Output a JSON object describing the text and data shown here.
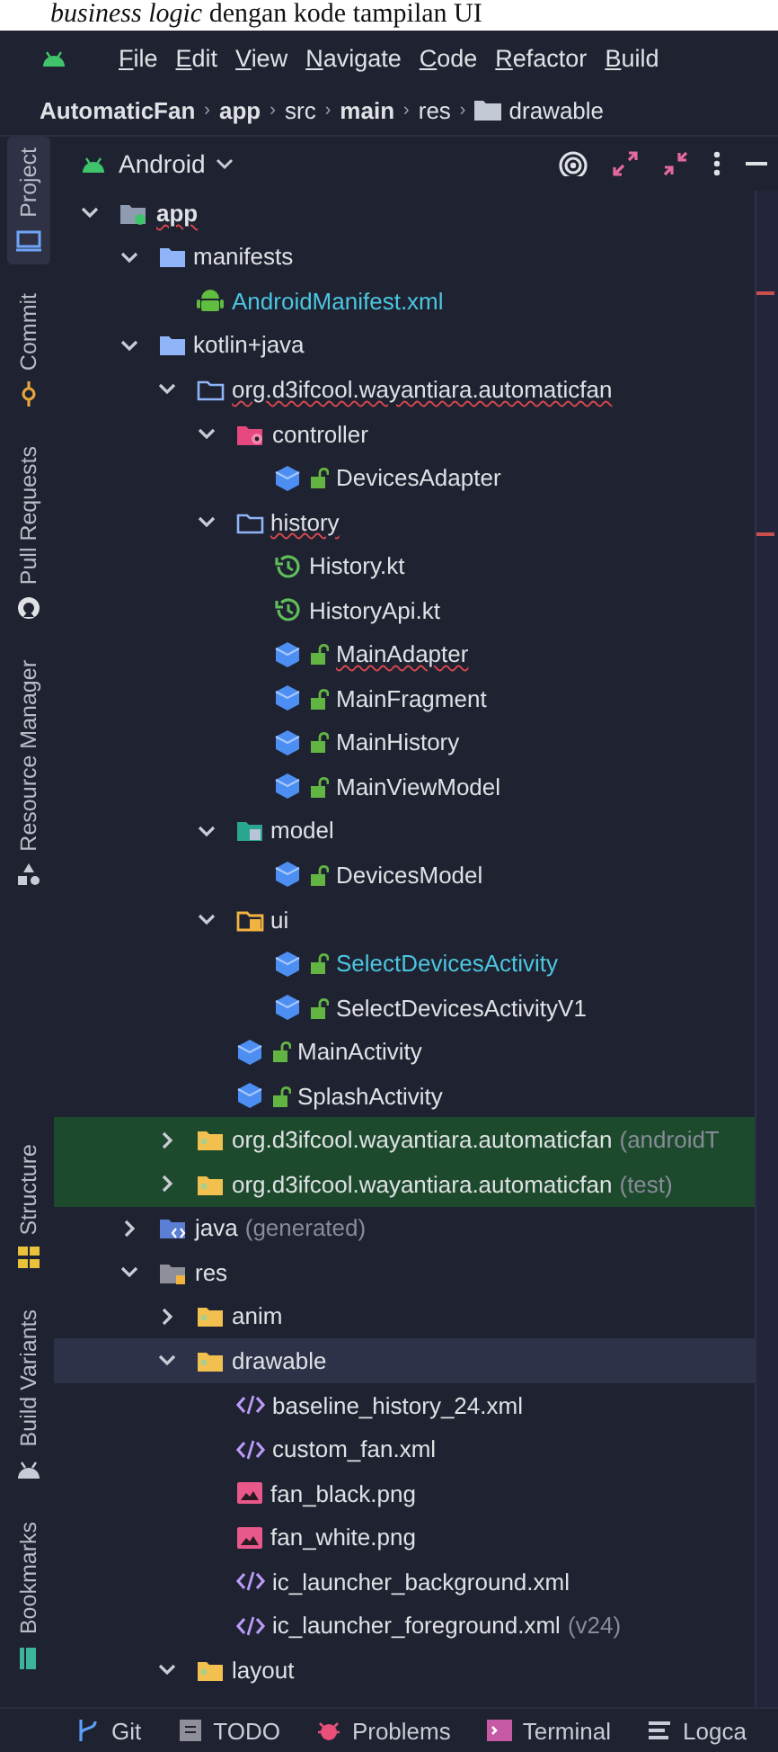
{
  "caption": "*business logic* dengan kode tampilan UI",
  "menu": [
    "File",
    "Edit",
    "View",
    "Navigate",
    "Code",
    "Refactor",
    "Build"
  ],
  "breadcrumb": [
    {
      "label": "AutomaticFan",
      "bold": true,
      "kind": "text"
    },
    {
      "separator": "›",
      "label": "app",
      "bold": true,
      "kind": "text"
    },
    {
      "separator": "›",
      "label": "src",
      "bold": false,
      "kind": "text"
    },
    {
      "separator": "›",
      "label": "main",
      "bold": true,
      "kind": "text"
    },
    {
      "separator": "›",
      "label": "res",
      "bold": false,
      "kind": "text"
    },
    {
      "separator": "›",
      "label": "drawable",
      "bold": false,
      "kind": "folder"
    }
  ],
  "tool_windows_top": [
    {
      "label": "Project",
      "kind": "project",
      "selected": true
    },
    {
      "label": "Commit",
      "kind": "commit",
      "selected": false
    },
    {
      "label": "Pull Requests",
      "kind": "pull",
      "selected": false
    },
    {
      "label": "Resource Manager",
      "kind": "resources",
      "selected": false
    }
  ],
  "tool_windows_bottom": [
    {
      "label": "Structure",
      "kind": "structure",
      "selected": false
    },
    {
      "label": "Build Variants",
      "kind": "variants",
      "selected": false
    },
    {
      "label": "Bookmarks",
      "kind": "bookmarks",
      "selected": false
    }
  ],
  "view_selector": "Android",
  "tree": [
    {
      "label": "app",
      "kind": "module",
      "expanded": true,
      "selected": false,
      "modified": false,
      "error": true,
      "children": [
        {
          "label": "manifests",
          "kind": "folder",
          "expanded": true,
          "selected": false,
          "modified": false,
          "error": false,
          "children": [
            {
              "label": "AndroidManifest.xml",
              "kind": "manifest",
              "selected": false,
              "modified": true,
              "error": false
            }
          ]
        },
        {
          "label": "kotlin+java",
          "kind": "folder",
          "expanded": true,
          "selected": false,
          "modified": false,
          "error": false,
          "children": [
            {
              "label": "org.d3ifcool.wayantiara.automaticfan",
              "kind": "package",
              "expanded": true,
              "selected": false,
              "modified": false,
              "error": true,
              "children": [
                {
                  "label": "controller",
                  "kind": "package-controller",
                  "expanded": true,
                  "selected": false,
                  "modified": false,
                  "error": false,
                  "children": [
                    {
                      "label": "DevicesAdapter",
                      "kind": "class",
                      "selected": false,
                      "modified": false,
                      "error": false
                    }
                  ]
                },
                {
                  "label": "history",
                  "kind": "package",
                  "expanded": true,
                  "selected": false,
                  "modified": false,
                  "error": true,
                  "children": [
                    {
                      "label": "History.kt",
                      "kind": "kotlin-file",
                      "selected": false,
                      "modified": false,
                      "error": false
                    },
                    {
                      "label": "HistoryApi.kt",
                      "kind": "kotlin-file",
                      "selected": false,
                      "modified": false,
                      "error": false
                    },
                    {
                      "label": "MainAdapter",
                      "kind": "class",
                      "selected": false,
                      "modified": false,
                      "error": true
                    },
                    {
                      "label": "MainFragment",
                      "kind": "class",
                      "selected": false,
                      "modified": false,
                      "error": false
                    },
                    {
                      "label": "MainHistory",
                      "kind": "class",
                      "selected": false,
                      "modified": false,
                      "error": false
                    },
                    {
                      "label": "MainViewModel",
                      "kind": "class",
                      "selected": false,
                      "modified": false,
                      "error": false
                    }
                  ]
                },
                {
                  "label": "model",
                  "kind": "package-model",
                  "expanded": true,
                  "selected": false,
                  "modified": false,
                  "error": false,
                  "children": [
                    {
                      "label": "DevicesModel",
                      "kind": "class",
                      "selected": false,
                      "modified": false,
                      "error": false
                    }
                  ]
                },
                {
                  "label": "ui",
                  "kind": "package-ui",
                  "expanded": true,
                  "selected": false,
                  "modified": false,
                  "error": false,
                  "children": [
                    {
                      "label": "SelectDevicesActivity",
                      "kind": "class",
                      "selected": false,
                      "modified": true,
                      "error": false
                    },
                    {
                      "label": "SelectDevicesActivityV1",
                      "kind": "class",
                      "selected": false,
                      "modified": false,
                      "error": false
                    }
                  ]
                },
                {
                  "label": "MainActivity",
                  "kind": "class",
                  "selected": false,
                  "modified": false,
                  "error": false
                },
                {
                  "label": "SplashActivity",
                  "kind": "class",
                  "selected": false,
                  "modified": false,
                  "error": false
                }
              ]
            },
            {
              "label": "org.d3ifcool.wayantiara.automaticfan",
              "note": "(androidT",
              "kind": "test-package",
              "expanded": false,
              "selected": false,
              "modified": false,
              "error": false
            },
            {
              "label": "org.d3ifcool.wayantiara.automaticfan",
              "note": "(test)",
              "kind": "test-package",
              "expanded": false,
              "selected": false,
              "modified": false,
              "error": false
            }
          ]
        },
        {
          "label": "java",
          "note": "(generated)",
          "kind": "generated",
          "expanded": false,
          "selected": false,
          "modified": false,
          "error": false
        },
        {
          "label": "res",
          "kind": "res",
          "expanded": true,
          "selected": false,
          "modified": false,
          "error": false,
          "children": [
            {
              "label": "anim",
              "kind": "res-folder",
              "expanded": false,
              "selected": false,
              "modified": false,
              "error": false
            },
            {
              "label": "drawable",
              "kind": "res-folder",
              "expanded": true,
              "selected": true,
              "modified": false,
              "error": false,
              "children": [
                {
                  "label": "baseline_history_24.xml",
                  "kind": "xml",
                  "selected": false,
                  "modified": false,
                  "error": false
                },
                {
                  "label": "custom_fan.xml",
                  "kind": "xml",
                  "selected": false,
                  "modified": false,
                  "error": false
                },
                {
                  "label": "fan_black.png",
                  "kind": "image",
                  "selected": false,
                  "modified": false,
                  "error": false
                },
                {
                  "label": "fan_white.png",
                  "kind": "image",
                  "selected": false,
                  "modified": false,
                  "error": false
                },
                {
                  "label": "ic_launcher_background.xml",
                  "kind": "xml",
                  "selected": false,
                  "modified": false,
                  "error": false
                },
                {
                  "label": "ic_launcher_foreground.xml",
                  "note": "(v24)",
                  "kind": "xml",
                  "selected": false,
                  "modified": false,
                  "error": false
                }
              ]
            },
            {
              "label": "layout",
              "kind": "res-folder",
              "expanded": true,
              "selected": false,
              "modified": false,
              "error": false
            }
          ]
        }
      ]
    }
  ],
  "bottom_tools": [
    {
      "label": "Git",
      "kind": "git"
    },
    {
      "label": "TODO",
      "kind": "todo"
    },
    {
      "label": "Problems",
      "kind": "problems"
    },
    {
      "label": "Terminal",
      "kind": "terminal"
    },
    {
      "label": "Logca",
      "kind": "logcat"
    }
  ]
}
